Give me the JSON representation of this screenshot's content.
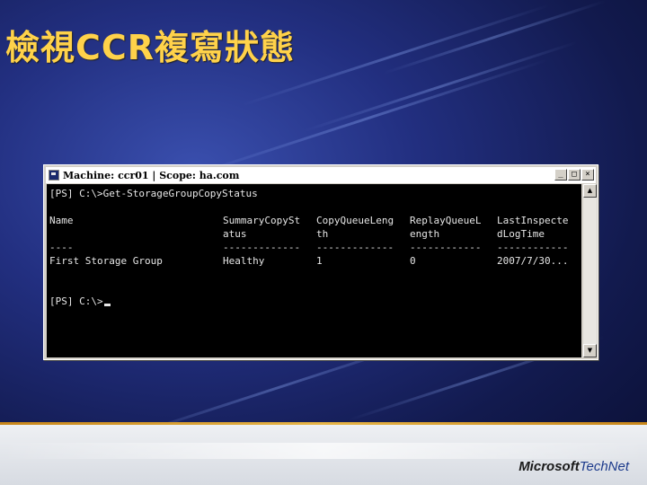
{
  "slide": {
    "title": "檢視CCR複寫狀態"
  },
  "window": {
    "title": "Machine: ccr01 | Scope: ha.com",
    "icons": {
      "app": "powershell-icon",
      "minimize": "minimize-icon",
      "maximize": "maximize-icon",
      "close": "close-icon"
    }
  },
  "console": {
    "command_line": "[PS] C:\\>Get-StorageGroupCopyStatus",
    "prompt_line": "[PS] C:\\>",
    "headers_row1": [
      "Name",
      "SummaryCopySt",
      "CopyQueueLeng",
      "ReplayQueueL",
      "LastInspecte"
    ],
    "headers_row2": [
      "",
      "atus",
      "th",
      "ength",
      "dLogTime"
    ],
    "separators": [
      "----",
      "-------------",
      "-------------",
      "------------",
      "------------"
    ],
    "row": [
      "First Storage Group",
      "Healthy",
      "1",
      "0",
      "2007/7/30..."
    ]
  },
  "footer": {
    "logo_microsoft": "Microsoft",
    "logo_technet": "TechNet"
  },
  "colors": {
    "title": "#ffd24a",
    "console_bg": "#000000",
    "console_fg": "#e6e6e6",
    "accent_line": "#e7b547"
  }
}
